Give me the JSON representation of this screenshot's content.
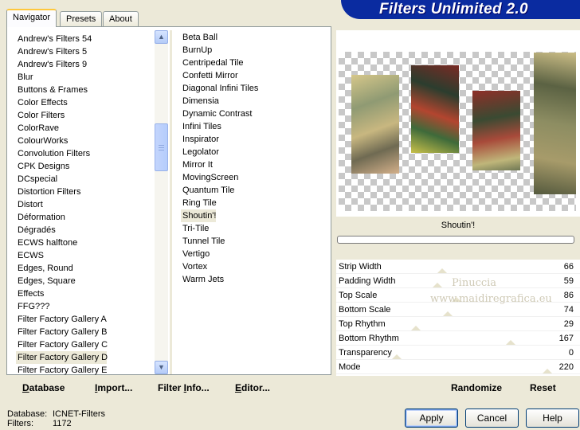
{
  "tabs": [
    "Navigator",
    "Presets",
    "About"
  ],
  "banner": "Filters Unlimited 2.0",
  "categories": [
    "Andrew's Filters 54",
    "Andrew's Filters 5",
    "Andrew's Filters 9",
    "Blur",
    "Buttons & Frames",
    "Color Effects",
    "Color Filters",
    "ColorRave",
    "ColourWorks",
    "Convolution Filters",
    "CPK Designs",
    "DCspecial",
    "Distortion Filters",
    "Distort",
    "Déformation",
    "Dégradés",
    "ECWS halftone",
    "ECWS",
    "Edges, Round",
    "Edges, Square",
    "Effects",
    "FFG???",
    "Filter Factory Gallery A",
    "Filter Factory Gallery B",
    "Filter Factory Gallery C",
    "Filter Factory Gallery D",
    "Filter Factory Gallery E"
  ],
  "selected_category": "Filter Factory Gallery D",
  "filters": [
    "Beta Ball",
    "BurnUp",
    "Centripedal Tile",
    "Confetti Mirror",
    "Diagonal Infini Tiles",
    "Dimensia",
    "Dynamic Contrast",
    "Infini Tiles",
    "Inspirator",
    "Legolator",
    "Mirror It",
    "MovingScreen",
    "Quantum Tile",
    "Ring Tile",
    "Shoutin'!",
    "Tri-Tile",
    "Tunnel Tile",
    "Vertigo",
    "Vortex",
    "Warm Jets"
  ],
  "selected_filter": "Shoutin'!",
  "list_buttons": {
    "database": {
      "u": "D",
      "rest": "atabase"
    },
    "import": {
      "u": "I",
      "rest": "mport..."
    },
    "filter_info": {
      "pre": "Filter ",
      "u": "I",
      "rest": "nfo..."
    },
    "editor": {
      "u": "E",
      "rest": "ditor..."
    }
  },
  "preview_filter_name": "Shoutin'!",
  "params": [
    {
      "label": "Strip Width",
      "value": 66,
      "fraction": 0.26
    },
    {
      "label": "Padding Width",
      "value": 59,
      "fraction": 0.23
    },
    {
      "label": "Top Scale",
      "value": 86,
      "fraction": 0.34
    },
    {
      "label": "Bottom Scale",
      "value": 74,
      "fraction": 0.29
    },
    {
      "label": "Top Rhythm",
      "value": 29,
      "fraction": 0.11
    },
    {
      "label": "Bottom Rhythm",
      "value": 167,
      "fraction": 0.65
    },
    {
      "label": "Transparency",
      "value": 0,
      "fraction": 0.0
    },
    {
      "label": "Mode",
      "value": 220,
      "fraction": 0.86
    }
  ],
  "watermark": {
    "line1": "Pinuccia",
    "line2": "www.maidiregrafica.eu"
  },
  "right_buttons": {
    "randomize": "Randomize",
    "reset": "Reset"
  },
  "footer": {
    "database_label": "Database:",
    "database_value": "ICNET-Filters",
    "filters_label": "Filters:",
    "filters_value": "1172"
  },
  "dialog_buttons": {
    "apply": "Apply",
    "cancel": "Cancel",
    "help": "Help"
  },
  "colors": {
    "banner": "#0a2ba0",
    "selection": "#ece9d8",
    "window": "#ece9d8"
  }
}
